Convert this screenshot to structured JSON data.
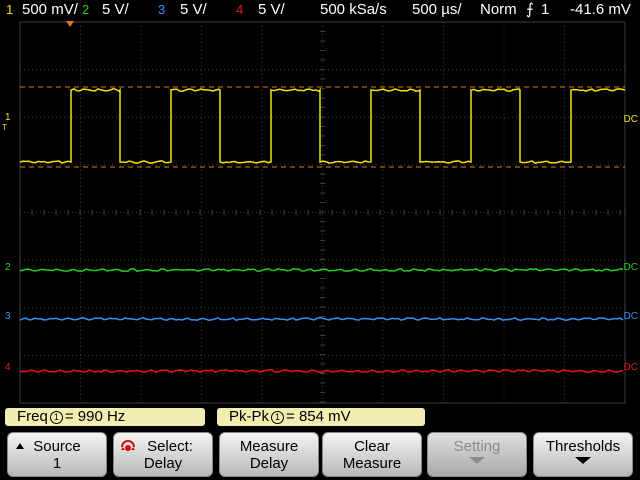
{
  "status": {
    "ch1_num": "1",
    "ch1_scale": "500 mV/",
    "ch2_num": "2",
    "ch2_scale": "5 V/",
    "ch3_num": "3",
    "ch3_scale": "5 V/",
    "ch4_num": "4",
    "ch4_scale": "5 V/",
    "sample_rate": "500 kSa/s",
    "timebase": "500 µs/",
    "trigger_mode": "Norm",
    "trigger_source": "1",
    "trigger_level": "-41.6 mV"
  },
  "markers": {
    "ch1": "1",
    "ch2": "2",
    "ch3": "3",
    "ch4": "4",
    "dc": "DC",
    "trigger_level_marker": "T"
  },
  "colors": {
    "ch1": "#f2e600",
    "ch2": "#20d020",
    "ch3": "#3a8ff5",
    "ch4": "#e81414",
    "grid": "#3b3b3b",
    "cursor": "#e07a1a"
  },
  "measurements": [
    {
      "label": "Freq",
      "source": "1",
      "value": "990  Hz"
    },
    {
      "label": "Pk-Pk",
      "source": "1",
      "value": "854 mV"
    }
  ],
  "softkeys": [
    {
      "line1": "Source",
      "line2": "1"
    },
    {
      "line1": "Select:",
      "line2": "Delay"
    },
    {
      "line1": "Measure",
      "line2": "Delay"
    },
    {
      "line1": "Clear",
      "line2": "Measure"
    },
    {
      "line1": "Setting",
      "line2": ""
    },
    {
      "line1": "Thresholds",
      "line2": ""
    }
  ]
}
